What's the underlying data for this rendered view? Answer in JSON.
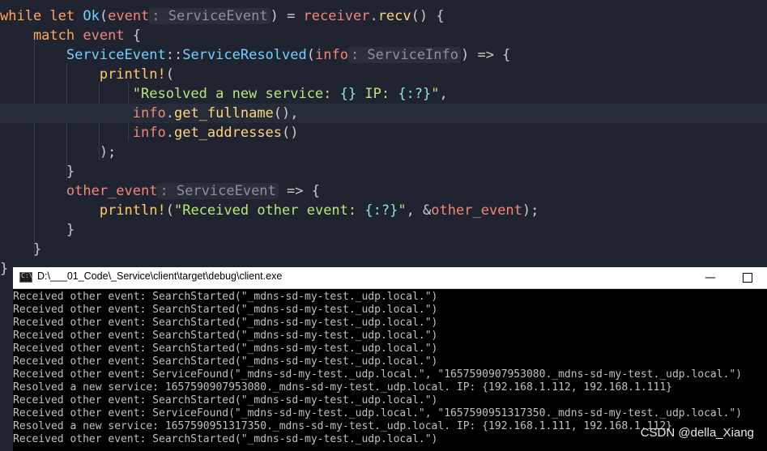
{
  "editor": {
    "lines": [
      [
        {
          "t": "while ",
          "c": "kw"
        },
        {
          "t": "let ",
          "c": "kw"
        },
        {
          "t": "Ok",
          "c": "ty"
        },
        {
          "t": "(",
          "c": "op"
        },
        {
          "t": "event",
          "c": "var"
        },
        {
          "t": ": ServiceEvent",
          "c": "hint"
        },
        {
          "t": ") = ",
          "c": "op"
        },
        {
          "t": "receiver",
          "c": "var"
        },
        {
          "t": ".",
          "c": "op"
        },
        {
          "t": "recv",
          "c": "fn"
        },
        {
          "t": "() {",
          "c": "op"
        }
      ],
      [
        {
          "t": "    match ",
          "c": "kw"
        },
        {
          "t": "event",
          "c": "var"
        },
        {
          "t": " {",
          "c": "op"
        }
      ],
      [
        {
          "t": "        ",
          "c": "op"
        },
        {
          "t": "ServiceEvent",
          "c": "ty"
        },
        {
          "t": "::",
          "c": "op"
        },
        {
          "t": "ServiceResolved",
          "c": "ty"
        },
        {
          "t": "(",
          "c": "op"
        },
        {
          "t": "info",
          "c": "var"
        },
        {
          "t": ": ServiceInfo",
          "c": "hint"
        },
        {
          "t": ") => {",
          "c": "op"
        }
      ],
      [
        {
          "t": "            ",
          "c": "op"
        },
        {
          "t": "println!",
          "c": "mac"
        },
        {
          "t": "(",
          "c": "op"
        }
      ],
      [
        {
          "t": "                ",
          "c": "op"
        },
        {
          "t": "\"Resolved a new service: ",
          "c": "str"
        },
        {
          "t": "{}",
          "c": "fmt"
        },
        {
          "t": " IP: ",
          "c": "str"
        },
        {
          "t": "{:?}",
          "c": "fmt"
        },
        {
          "t": "\"",
          "c": "str"
        },
        {
          "t": ",",
          "c": "op"
        }
      ],
      [
        {
          "t": "                ",
          "c": "op"
        },
        {
          "t": "info",
          "c": "var"
        },
        {
          "t": ".",
          "c": "op"
        },
        {
          "t": "get_fullname",
          "c": "fn"
        },
        {
          "t": "(),",
          "c": "op"
        }
      ],
      [
        {
          "t": "                ",
          "c": "op"
        },
        {
          "t": "info",
          "c": "var"
        },
        {
          "t": ".",
          "c": "op"
        },
        {
          "t": "get_addresses",
          "c": "fn"
        },
        {
          "t": "()",
          "c": "op"
        }
      ],
      [
        {
          "t": "            );",
          "c": "op"
        }
      ],
      [
        {
          "t": "        }",
          "c": "op"
        }
      ],
      [
        {
          "t": "        ",
          "c": "op"
        },
        {
          "t": "other_event",
          "c": "var"
        },
        {
          "t": ": ServiceEvent",
          "c": "hint"
        },
        {
          "t": " => {",
          "c": "op"
        }
      ],
      [
        {
          "t": "            ",
          "c": "op"
        },
        {
          "t": "println!",
          "c": "mac"
        },
        {
          "t": "(",
          "c": "op"
        },
        {
          "t": "\"Received other event: ",
          "c": "str"
        },
        {
          "t": "{:?}",
          "c": "fmt"
        },
        {
          "t": "\"",
          "c": "str"
        },
        {
          "t": ", &",
          "c": "op"
        },
        {
          "t": "other_event",
          "c": "var"
        },
        {
          "t": ");",
          "c": "op"
        }
      ],
      [
        {
          "t": "        }",
          "c": "op"
        }
      ],
      [
        {
          "t": "    }",
          "c": "op"
        }
      ],
      [
        {
          "t": "}",
          "c": "op"
        }
      ]
    ]
  },
  "console": {
    "title": "D:\\___01_Code\\_Service\\client\\target\\debug\\client.exe",
    "minimize_glyph": "—",
    "output": [
      "Received other event: SearchStarted(\"_mdns-sd-my-test._udp.local.\")",
      "Received other event: SearchStarted(\"_mdns-sd-my-test._udp.local.\")",
      "Received other event: SearchStarted(\"_mdns-sd-my-test._udp.local.\")",
      "Received other event: SearchStarted(\"_mdns-sd-my-test._udp.local.\")",
      "Received other event: SearchStarted(\"_mdns-sd-my-test._udp.local.\")",
      "Received other event: SearchStarted(\"_mdns-sd-my-test._udp.local.\")",
      "Received other event: ServiceFound(\"_mdns-sd-my-test._udp.local.\", \"1657590907953080._mdns-sd-my-test._udp.local.\")",
      "Resolved a new service: 1657590907953080._mdns-sd-my-test._udp.local. IP: {192.168.1.112, 192.168.1.111}",
      "Received other event: SearchStarted(\"_mdns-sd-my-test._udp.local.\")",
      "Received other event: ServiceFound(\"_mdns-sd-my-test._udp.local.\", \"1657590951317350._mdns-sd-my-test._udp.local.\")",
      "Resolved a new service: 1657590951317350._mdns-sd-my-test._udp.local. IP: {192.168.1.111, 192.168.1.112}",
      "Received other event: SearchStarted(\"_mdns-sd-my-test._udp.local.\")"
    ]
  },
  "watermark": "CSDN @della_Xiang"
}
